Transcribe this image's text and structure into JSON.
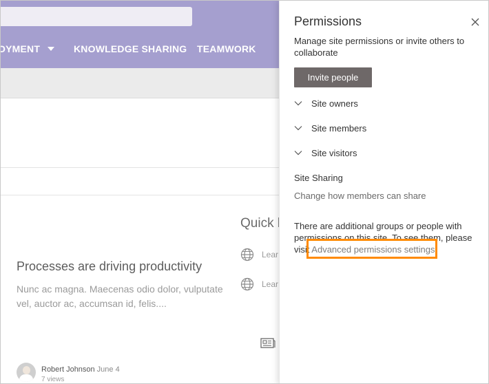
{
  "header": {
    "nav": [
      "OYMENT",
      "KNOWLEDGE SHARING",
      "TEAMWORK"
    ]
  },
  "news": {
    "title": "Processes are driving productivity",
    "description": "Nunc ac magna. Maecenas odio dolor, vulputate vel, auctor ac, accumsan id, felis....",
    "author": "Robert Johnson",
    "date": "June 4",
    "views": "7 views"
  },
  "quick_links": {
    "title": "Quick l",
    "items": [
      {
        "label": "Lear",
        "icon": "globe-icon"
      },
      {
        "label": "Lear",
        "icon": "globe-icon"
      }
    ]
  },
  "panel": {
    "title": "Permissions",
    "description": "Manage site permissions or invite others to collaborate",
    "invite_label": "Invite people",
    "groups": [
      {
        "label": "Site owners"
      },
      {
        "label": "Site members"
      },
      {
        "label": "Site visitors"
      }
    ],
    "sharing_title": "Site Sharing",
    "sharing_link": "Change how members can share",
    "additional_text": "There are additional groups or people with permissions on this site. To see them, please visit",
    "advanced_link": "Advanced permissions settings."
  },
  "colors": {
    "header_bg": "#a59fcf",
    "invite_bg": "#6e6868",
    "highlight": "#ff8a00"
  }
}
